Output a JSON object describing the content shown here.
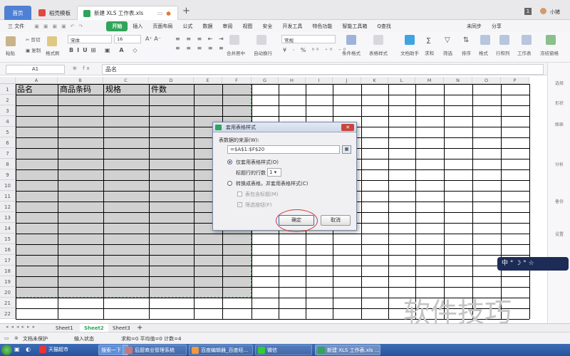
{
  "titlebar": {
    "tabs": [
      {
        "label": "首页"
      },
      {
        "label": "稻壳模板"
      },
      {
        "label": "新建 XLS 工作表.xls"
      }
    ],
    "new_tab_symbol": "+",
    "user_badge": "1",
    "user_name": "小猪"
  },
  "menubar": {
    "file": "三 文件",
    "items": [
      "开始",
      "插入",
      "页面布局",
      "公式",
      "数据",
      "审阅",
      "视图",
      "安全",
      "开发工具",
      "特色功能",
      "智能工具箱"
    ],
    "search": "Q查找",
    "sync": "未同步",
    "share": "分享",
    "colors": {
      "active": "#2fa45a"
    }
  },
  "ribbon": {
    "cut": "剪切",
    "copy": "复制",
    "paste": "粘贴",
    "format_painter": "格式刷",
    "font_name": "宋体",
    "font_size": "16",
    "merge_center": "合并居中",
    "wrap": "自动换行",
    "number_format": "常规",
    "conditional": "条件格式",
    "table_style": "表格样式",
    "doc_helper": "文档助手",
    "sum": "求和",
    "filter": "筛选",
    "sort": "排序",
    "format": "格式",
    "row_col": "行和列",
    "worksheet": "工作表",
    "freeze": "冻结窗格"
  },
  "formula_bar": {
    "name_box": "A1",
    "fx": "fx",
    "content": "品名"
  },
  "sheet": {
    "columns": [
      "A",
      "B",
      "C",
      "D",
      "E",
      "F",
      "G",
      "H",
      "I",
      "J",
      "K",
      "L",
      "M",
      "N",
      "O",
      "P"
    ],
    "rows": [
      "1",
      "2",
      "3",
      "4",
      "5",
      "6",
      "7",
      "8",
      "9",
      "10",
      "11",
      "12",
      "13",
      "14",
      "15",
      "16",
      "17",
      "18",
      "19",
      "20",
      "21",
      "22"
    ],
    "header_cells": [
      "品名",
      "商品条码",
      "规格",
      "件数"
    ]
  },
  "right_panel": [
    "选择",
    "形状",
    "图表",
    "分析",
    "备份",
    "设置"
  ],
  "dialog": {
    "title": "套用表格样式",
    "source_label": "表数据的来源(W):",
    "source_value": "=$A$1:$F$20",
    "option1": "仅套用表格样式(O)",
    "header_rows_label": "标题行的行数",
    "header_rows_value": "1",
    "option2": "转换成表格，并套用表格样式(C)",
    "check1": "表包含标题(M)",
    "check2": "筛选按钮(F)",
    "ok": "确定",
    "cancel": "取消"
  },
  "sheet_tabs": {
    "tabs": [
      "Sheet1",
      "Sheet2",
      "Sheet3"
    ],
    "active_index": 1,
    "add": "+"
  },
  "status_bar": {
    "doc_protect": "文档未保护",
    "input_state": "输入状态",
    "stats": "求和=0  平均值=0  计数=4"
  },
  "taskbar": {
    "items": [
      "天猫超市",
      "搜索一下",
      "后厨商业管理系统",
      "百度编辑器_百度经...",
      "微信",
      "新建 XLS 工作表.xls ..."
    ],
    "colors": {
      "bg": "#28529a"
    }
  },
  "ime_bar": "中 ° ☽ ° ☆",
  "watermark": "软件技巧"
}
